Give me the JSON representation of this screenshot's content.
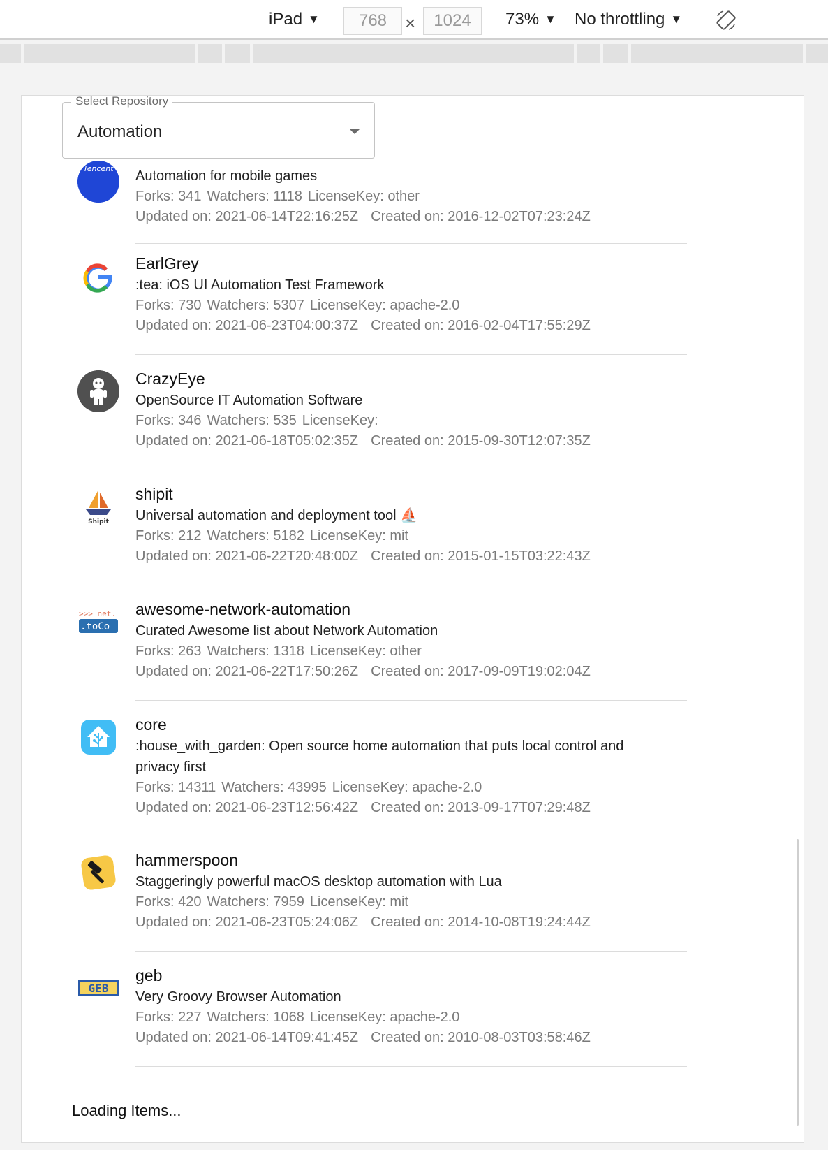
{
  "devtools": {
    "device": "iPad",
    "width": "768",
    "height": "1024",
    "times": "×",
    "zoom": "73%",
    "throttling": "No throttling",
    "caret": "▼"
  },
  "select": {
    "legend": "Select Repository",
    "value": "Automation"
  },
  "repos": [
    {
      "name": "",
      "description": "Automation for mobile games",
      "forks_label": "Forks: 341",
      "watchers_label": "Watchers: 1118",
      "license_label": "LicenseKey: other",
      "updated_label": "Updated on: 2021-06-14T22:16:25Z",
      "created_label": "Created on: 2016-12-02T07:23:24Z",
      "avatar_icon": "tencent-logo-icon",
      "avatar_text": "Tencent"
    },
    {
      "name": "EarlGrey",
      "description": ":tea: iOS UI Automation Test Framework",
      "forks_label": "Forks: 730",
      "watchers_label": "Watchers: 5307",
      "license_label": "LicenseKey: apache-2.0",
      "updated_label": "Updated on: 2021-06-23T04:00:37Z",
      "created_label": "Created on: 2016-02-04T17:55:29Z",
      "avatar_icon": "google-logo-icon"
    },
    {
      "name": "CrazyEye",
      "description": "OpenSource IT Automation Software",
      "forks_label": "Forks: 346",
      "watchers_label": "Watchers: 535",
      "license_label": "LicenseKey:",
      "updated_label": "Updated on: 2021-06-18T05:02:35Z",
      "created_label": "Created on: 2015-09-30T12:07:35Z",
      "avatar_icon": "person-silhouette-icon"
    },
    {
      "name": "shipit",
      "description": "Universal automation and deployment tool ⛵",
      "forks_label": "Forks: 212",
      "watchers_label": "Watchers: 5182",
      "license_label": "LicenseKey: mit",
      "updated_label": "Updated on: 2021-06-22T20:48:00Z",
      "created_label": "Created on: 2015-01-15T03:22:43Z",
      "avatar_icon": "sailboat-logo-icon",
      "avatar_text": "Shipit"
    },
    {
      "name": "awesome-network-automation",
      "description": "Curated Awesome list about Network Automation",
      "forks_label": "Forks: 263",
      "watchers_label": "Watchers: 1318",
      "license_label": "LicenseKey: other",
      "updated_label": "Updated on: 2021-06-22T17:50:26Z",
      "created_label": "Created on: 2017-09-09T19:02:04Z",
      "avatar_icon": "netoconf-logo-icon",
      "avatar_text_top": ">>> net.",
      "avatar_text_bottom": ".toCo"
    },
    {
      "name": "core",
      "description": ":house_with_garden: Open source home automation that puts local control and privacy first",
      "forks_label": "Forks: 14311",
      "watchers_label": "Watchers: 43995",
      "license_label": "LicenseKey: apache-2.0",
      "updated_label": "Updated on: 2021-06-23T12:56:42Z",
      "created_label": "Created on: 2013-09-17T07:29:48Z",
      "avatar_icon": "home-assistant-logo-icon"
    },
    {
      "name": "hammerspoon",
      "description": "Staggeringly powerful macOS desktop automation with Lua",
      "forks_label": "Forks: 420",
      "watchers_label": "Watchers: 7959",
      "license_label": "LicenseKey: mit",
      "updated_label": "Updated on: 2021-06-23T05:24:06Z",
      "created_label": "Created on: 2014-10-08T19:24:44Z",
      "avatar_icon": "hammer-logo-icon"
    },
    {
      "name": "geb",
      "description": "Very Groovy Browser Automation",
      "forks_label": "Forks: 227",
      "watchers_label": "Watchers: 1068",
      "license_label": "LicenseKey: apache-2.0",
      "updated_label": "Updated on: 2021-06-14T09:41:45Z",
      "created_label": "Created on: 2010-08-03T03:58:46Z",
      "avatar_icon": "geb-logo-icon",
      "avatar_text": "GEB"
    }
  ],
  "loading_text": "Loading Items..."
}
